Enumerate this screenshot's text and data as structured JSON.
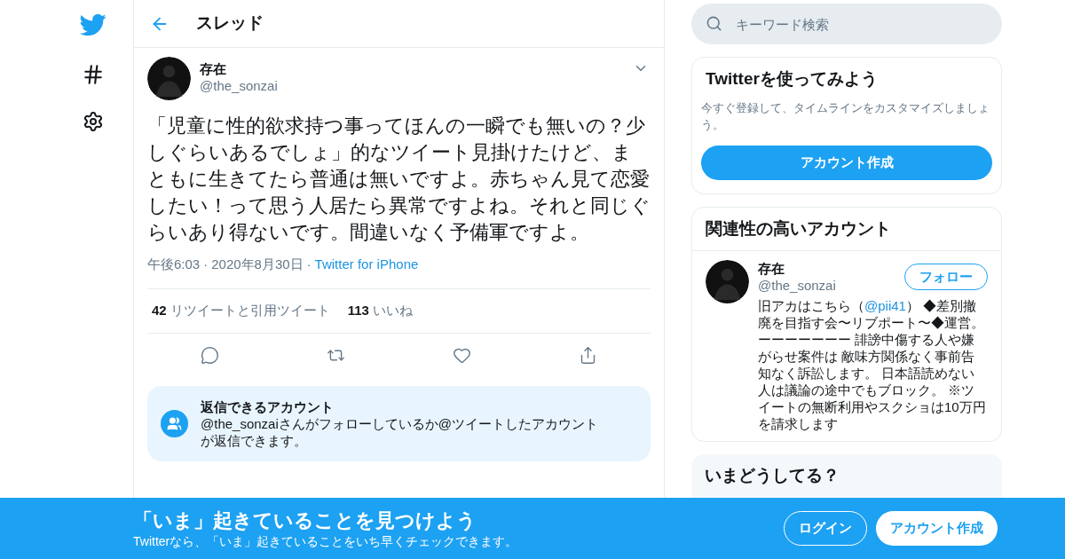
{
  "nav": [
    {
      "kind": "logo"
    },
    {
      "kind": "explore"
    },
    {
      "kind": "settings"
    }
  ],
  "header": {
    "title": "スレッド"
  },
  "tweet": {
    "name": "存在",
    "handle": "@the_sonzai",
    "text": "「児童に性的欲求持つ事ってほんの一瞬でも無いの？少しぐらいあるでしょ」的なツイート見掛けたけど、まともに生きてたら普通は無いですよ。赤ちゃん見て恋愛したい！って思う人居たら異常ですよね。それと同じぐらいあり得ないです。間違いなく予備軍ですよ。",
    "time": "午後6:03",
    "separator": "·",
    "date": "2020年8月30日",
    "source": "Twitter for iPhone",
    "stats": [
      {
        "count": "42",
        "label": "リツイートと引用ツイート"
      },
      {
        "count": "113",
        "label": "いいね"
      }
    ],
    "actions": [
      {
        "kind": "reply"
      },
      {
        "kind": "retweet"
      },
      {
        "kind": "like"
      },
      {
        "kind": "share"
      }
    ],
    "reply_notice": {
      "title": "返信できるアカウント",
      "text": "@the_sonzaiさんがフォローしているか@ツイートしたアカウントが返信できます。"
    }
  },
  "search": {
    "placeholder": "キーワード検索"
  },
  "signup_card": {
    "title": "Twitterを使ってみよう",
    "text": "今すぐ登録して、タイムラインをカスタマイズしましょう。",
    "button": "アカウント作成"
  },
  "related_card": {
    "title": "関連性の高いアカウント",
    "accounts": [
      {
        "name": "存在",
        "handle": "@the_sonzai",
        "follow": "フォロー",
        "bio_before": "旧アカはこちら（",
        "bio_link": "@pii41",
        "bio_after": "） ◆差別撤廃を目指す会〜リブポート〜◆運営。ーーーーーーー 誹謗中傷する人や嫌がらせ案件は 敵味方関係なく事前告知なく訴訟します。 日本語読めない人は議論の途中でもブロック。 ※ツイートの無断利用やスクショは10万円を請求します"
      }
    ]
  },
  "trends_card": {
    "title": "いまどうしてる？"
  },
  "banner": {
    "title": "「いま」起きていることを見つけよう",
    "text": "Twitterなら、「いま」起きていることをいち早くチェックできます。",
    "login": "ログイン",
    "signup": "アカウント作成"
  }
}
